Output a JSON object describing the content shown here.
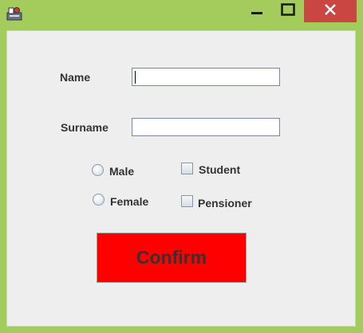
{
  "form": {
    "name_label": "Name",
    "name_value": "",
    "surname_label": "Surname",
    "surname_value": "",
    "gender_options": [
      "Male",
      "Female"
    ],
    "status_options": [
      "Student",
      "Pensioner"
    ],
    "confirm_label": "Confirm"
  },
  "colors": {
    "window_frame": "#a4cc5c",
    "close_button": "#c94643",
    "client_background": "#eeeeee",
    "confirm_button": "#ff0000"
  },
  "icons": [
    "app-icon",
    "minimize-icon",
    "maximize-icon",
    "close-icon"
  ]
}
